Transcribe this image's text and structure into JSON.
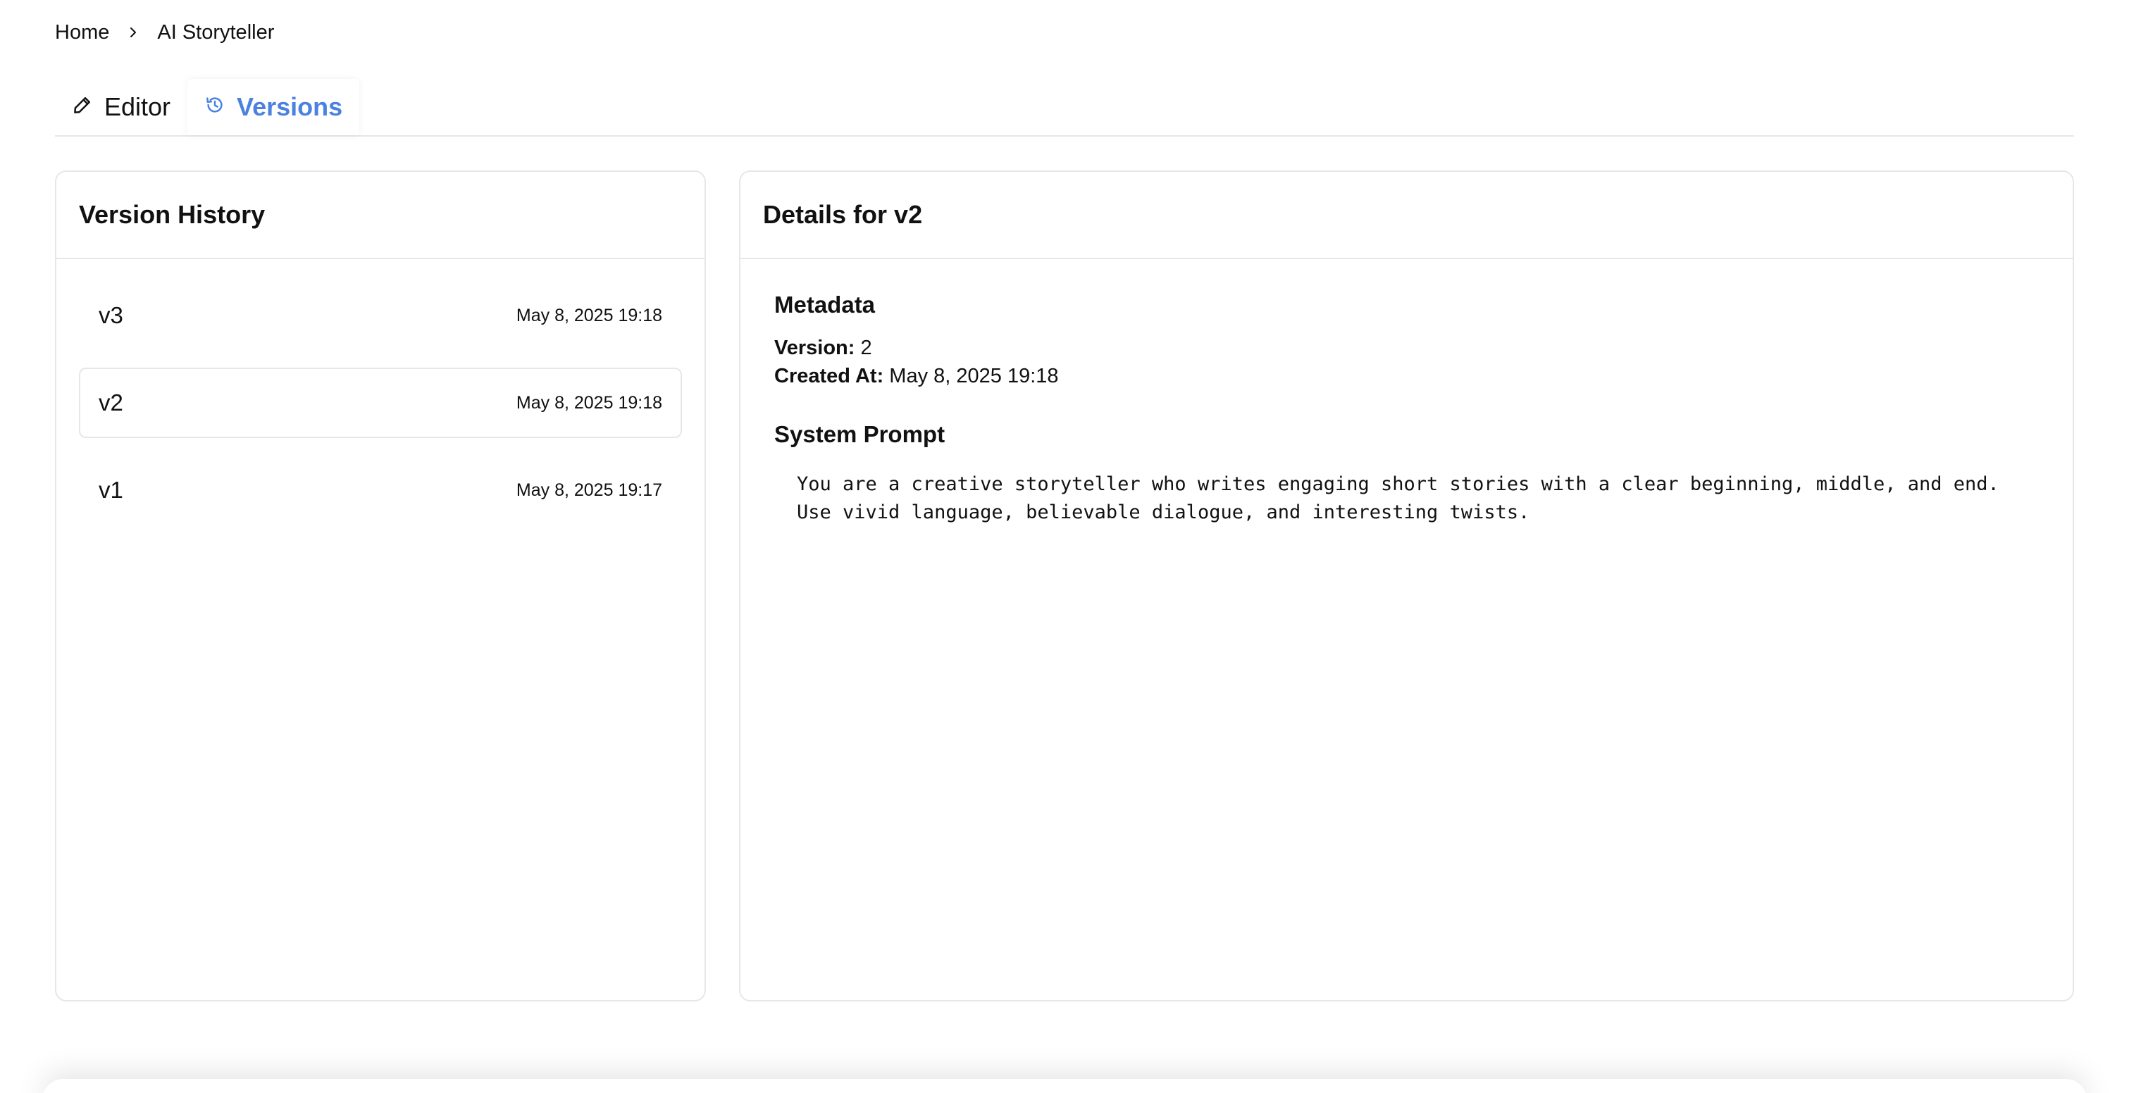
{
  "breadcrumb": {
    "home": "Home",
    "current": "AI Storyteller",
    "separator_icon": "chevron-right-icon"
  },
  "tabs": [
    {
      "label": "Editor",
      "icon": "pencil-icon",
      "active": false
    },
    {
      "label": "Versions",
      "icon": "history-icon",
      "active": true
    }
  ],
  "accent_color": "#4b82e0",
  "version_history": {
    "title": "Version History",
    "items": [
      {
        "label": "v3",
        "date": "May 8, 2025 19:18",
        "selected": false
      },
      {
        "label": "v2",
        "date": "May 8, 2025 19:18",
        "selected": true
      },
      {
        "label": "v1",
        "date": "May 8, 2025 19:17",
        "selected": false
      }
    ]
  },
  "details": {
    "title": "Details for v2",
    "metadata_title": "Metadata",
    "version_key": "Version:",
    "version_value": "2",
    "created_key": "Created At:",
    "created_value": "May 8, 2025 19:18",
    "system_prompt_title": "System Prompt",
    "system_prompt": "You are a creative storyteller who writes engaging short stories with a clear beginning, middle, and end. Use vivid language, believable dialogue, and interesting twists."
  }
}
